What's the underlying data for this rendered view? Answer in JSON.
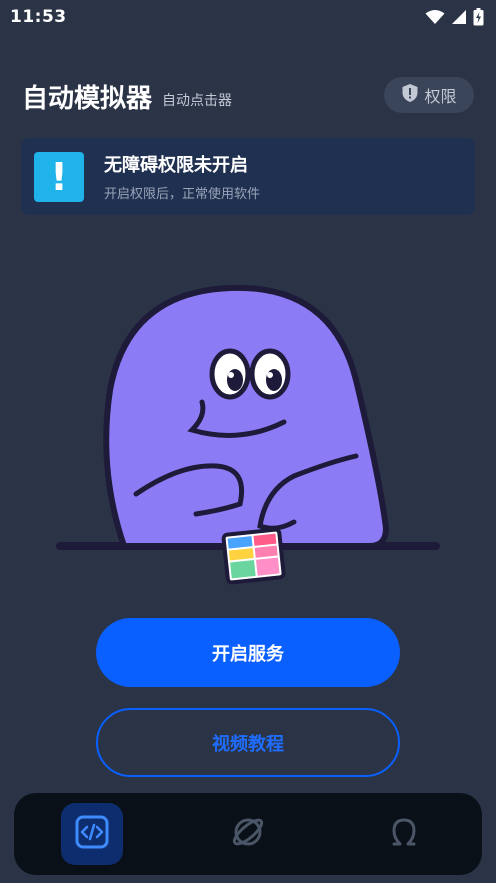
{
  "status_bar": {
    "time": "11:53",
    "icons": [
      "wifi-icon",
      "signal-icon",
      "battery-charging-icon"
    ]
  },
  "header": {
    "title": "自动模拟器",
    "subtitle": "自动点击器",
    "permission_button": {
      "icon": "shield-icon",
      "label": "权限"
    }
  },
  "warning": {
    "icon": "exclamation-icon",
    "title": "无障碍权限未开启",
    "description": "开启权限后，正常使用软件"
  },
  "illustration": {
    "name": "purple-blob-mascot-with-phone"
  },
  "actions": {
    "start_service": "开启服务",
    "video_tutorial": "视频教程"
  },
  "bottom_nav": {
    "items": [
      {
        "icon": "code-icon",
        "active": true
      },
      {
        "icon": "planet-icon",
        "active": false
      },
      {
        "icon": "profile-icon",
        "active": false
      }
    ]
  },
  "colors": {
    "background": "#2b3446",
    "primary": "#0a5fff",
    "card": "#1f3050",
    "warning_icon": "#20b3ea",
    "nav_bg": "#0a1018",
    "mascot": "#8b7cf6"
  }
}
